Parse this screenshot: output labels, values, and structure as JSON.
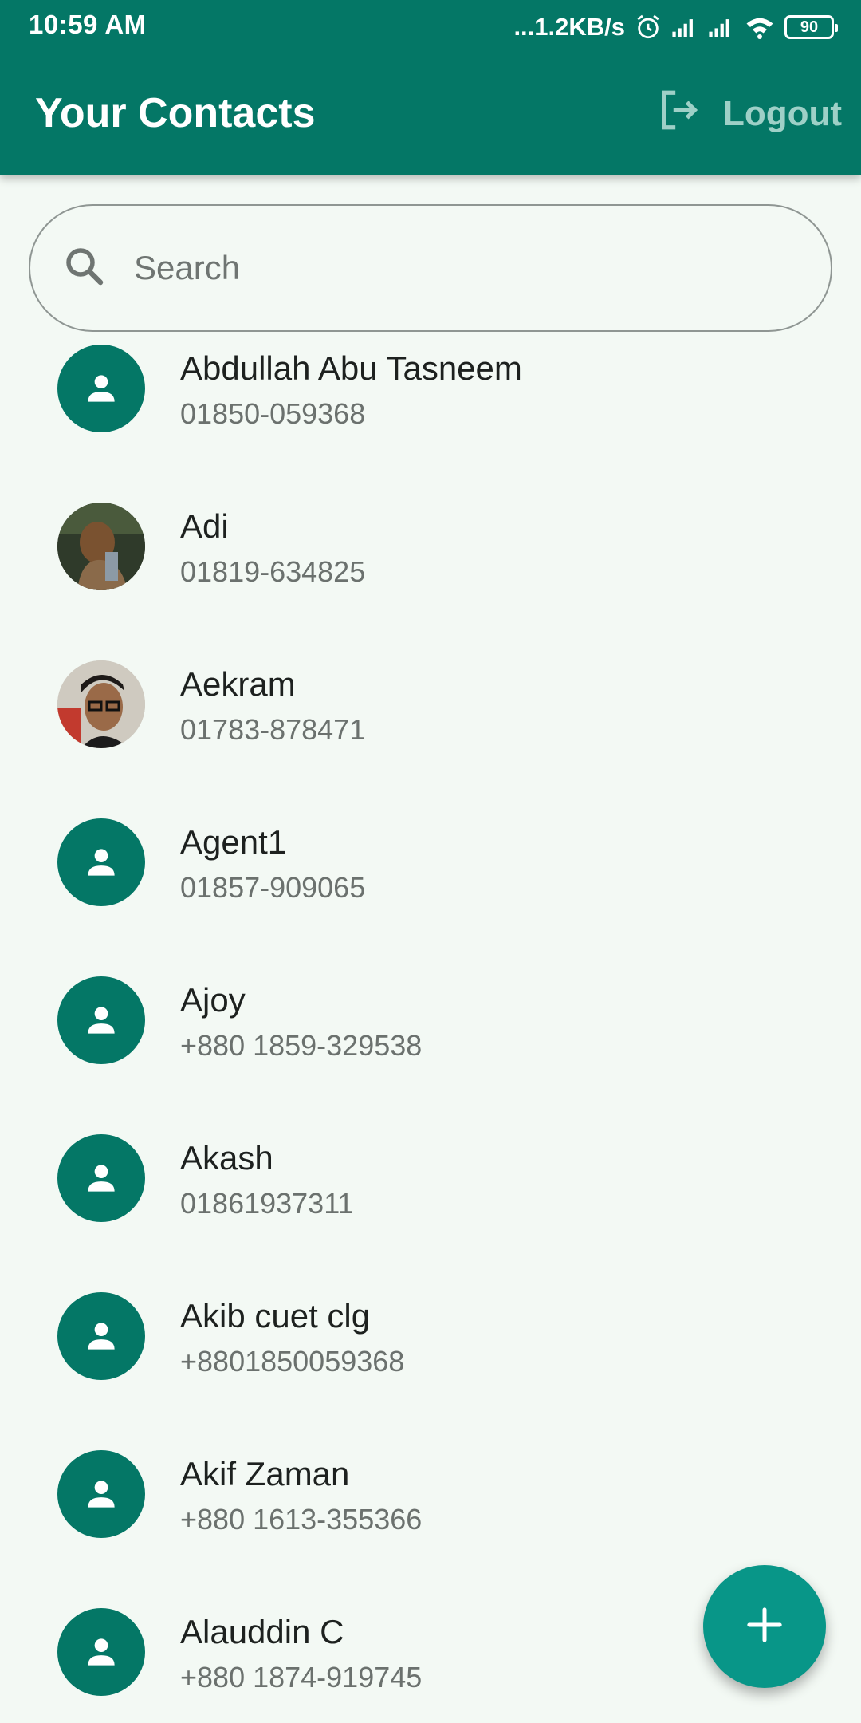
{
  "status_bar": {
    "time": "10:59 AM",
    "net_speed": "...1.2KB/s",
    "battery": "90",
    "icons": [
      "alarm-icon",
      "signal-icon",
      "signal-icon",
      "wifi-icon",
      "battery-icon"
    ]
  },
  "app_bar": {
    "title": "Your Contacts",
    "logout_label": "Logout",
    "logout_icon": "logout-icon"
  },
  "search": {
    "placeholder": "Search",
    "value": "",
    "icon": "search-icon"
  },
  "contacts": [
    {
      "name": "Abdullah Abu Tasneem",
      "phone": "01850-059368",
      "avatar": "default-person-icon"
    },
    {
      "name": "Adi",
      "phone": "01819-634825",
      "avatar": "photo"
    },
    {
      "name": "Aekram",
      "phone": "01783-878471",
      "avatar": "photo"
    },
    {
      "name": "Agent1",
      "phone": "01857-909065",
      "avatar": "default-person-icon"
    },
    {
      "name": "Ajoy",
      "phone": "+880 1859-329538",
      "avatar": "default-person-icon"
    },
    {
      "name": "Akash",
      "phone": "01861937311",
      "avatar": "default-person-icon"
    },
    {
      "name": "Akib cuet clg",
      "phone": "+8801850059368",
      "avatar": "default-person-icon"
    },
    {
      "name": "Akif Zaman",
      "phone": "+880 1613-355366",
      "avatar": "default-person-icon"
    },
    {
      "name": "Alauddin C",
      "phone": "+880 1874-919745",
      "avatar": "default-person-icon"
    }
  ],
  "fab": {
    "icon": "plus-icon"
  },
  "colors": {
    "primary": "#047766",
    "accent": "#089688",
    "background": "#f3f9f4",
    "logout_text": "#9ed0c7"
  }
}
